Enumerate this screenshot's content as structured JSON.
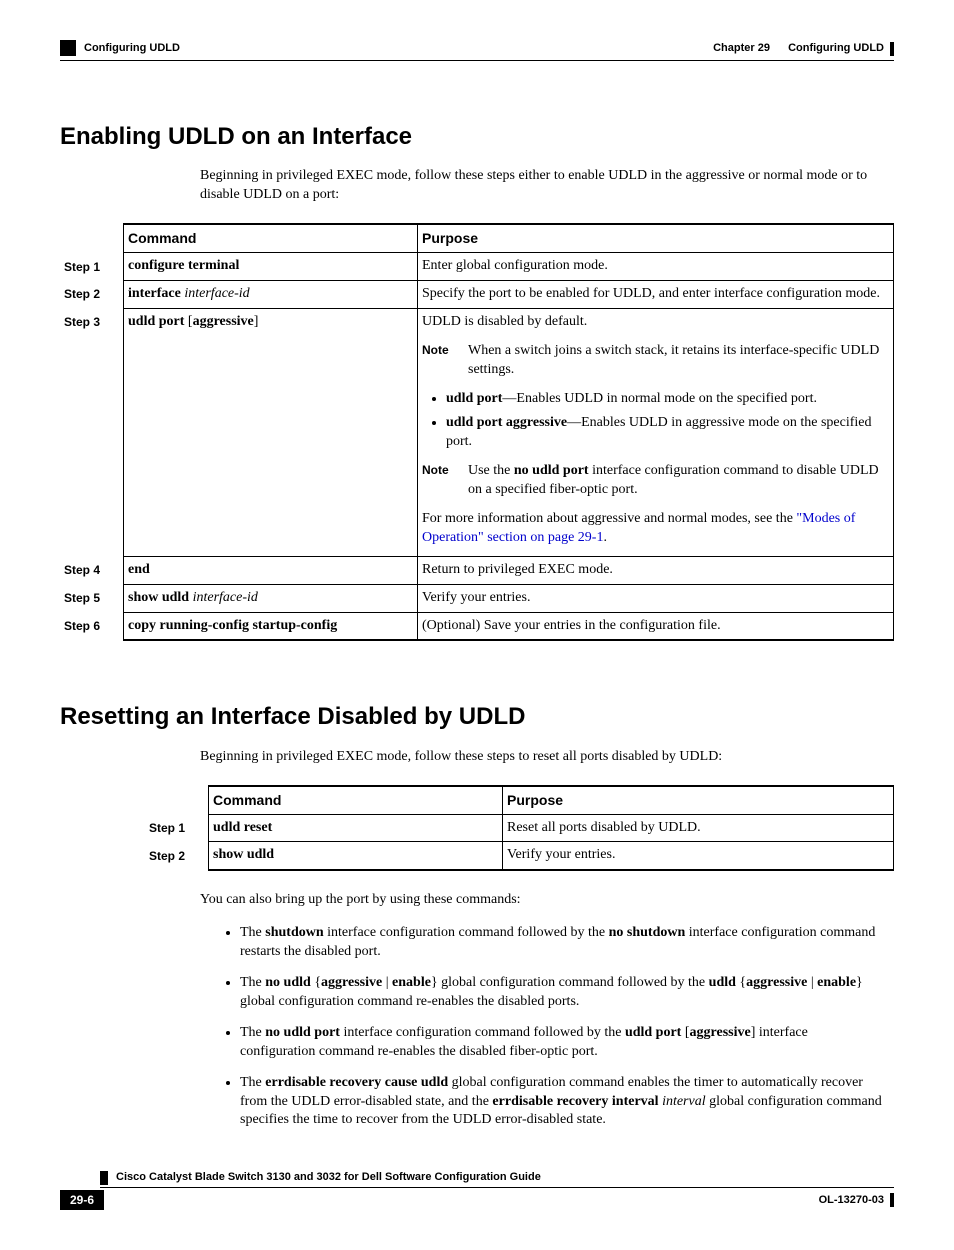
{
  "header": {
    "left": "Configuring UDLD",
    "right_chapter": "Chapter 29",
    "right_title": "Configuring UDLD"
  },
  "section1": {
    "title": "Enabling UDLD on an Interface",
    "intro": "Beginning in privileged EXEC mode, follow these steps either to enable UDLD in the aggressive or normal mode or to disable UDLD on a port:",
    "th_command": "Command",
    "th_purpose": "Purpose",
    "steps": {
      "s1": {
        "label": "Step 1",
        "cmd_b": "configure terminal",
        "purpose": "Enter global configuration mode."
      },
      "s2": {
        "label": "Step 2",
        "cmd_b": "interface",
        "cmd_i": "interface-id",
        "purpose": "Specify the port to be enabled for UDLD, and enter interface configuration mode."
      },
      "s3": {
        "label": "Step 3",
        "cmd_b": "udld port",
        "cmd_plain_open": " [",
        "cmd_b2": "aggressive",
        "cmd_plain_close": "]",
        "p1": "UDLD is disabled by default.",
        "note1_label": "Note",
        "note1_text": "When a switch joins a switch stack, it retains its interface-specific UDLD settings.",
        "b1_b": "udld port",
        "b1_rest": "—Enables UDLD in normal mode on the specified port.",
        "b2_b": "udld port aggressive",
        "b2_rest": "—Enables UDLD in aggressive mode on the specified port.",
        "note2_label": "Note",
        "note2_pre": "Use the ",
        "note2_b": "no udld port",
        "note2_post": " interface configuration command to disable UDLD on a specified fiber-optic port.",
        "p2_pre": "For more information about aggressive and normal modes, see the ",
        "p2_link": "\"Modes of Operation\" section on page 29-1",
        "p2_post": "."
      },
      "s4": {
        "label": "Step 4",
        "cmd_b": "end",
        "purpose": "Return to privileged EXEC mode."
      },
      "s5": {
        "label": "Step 5",
        "cmd_b": "show udld",
        "cmd_i": "interface-id",
        "purpose": "Verify your entries."
      },
      "s6": {
        "label": "Step 6",
        "cmd_b": "copy running-config startup-config",
        "purpose": "(Optional) Save your entries in the configuration file."
      }
    }
  },
  "section2": {
    "title": "Resetting an Interface Disabled by UDLD",
    "intro": "Beginning in privileged EXEC mode, follow these steps to reset all ports disabled by UDLD:",
    "th_command": "Command",
    "th_purpose": "Purpose",
    "steps": {
      "s1": {
        "label": "Step 1",
        "cmd_b": "udld reset",
        "purpose": "Reset all ports disabled by UDLD."
      },
      "s2": {
        "label": "Step 2",
        "cmd_b": "show udld",
        "purpose": "Verify your entries."
      }
    },
    "after": "You can also bring up the port by using these commands:",
    "bullets": {
      "b1": {
        "t1": "The ",
        "b1": "shutdown",
        "t2": " interface configuration command followed by the ",
        "b2": "no shutdown",
        "t3": " interface configuration command restarts the disabled port."
      },
      "b2": {
        "t1": "The ",
        "b1": "no udld",
        "t2": " {",
        "b2": "aggressive",
        "t3": " | ",
        "b3": "enable",
        "t4": "} global configuration command followed by the ",
        "b4": "udld",
        "t5": " {",
        "b5": "aggressive",
        "t6": " | ",
        "b6": "enable",
        "t7": "} global configuration command re-enables the disabled ports."
      },
      "b3": {
        "t1": "The ",
        "b1": "no udld port",
        "t2": " interface configuration command followed by the ",
        "b2": "udld port",
        "t3": " [",
        "b3": "aggressive",
        "t4": "] interface configuration command re-enables the disabled fiber-optic port."
      },
      "b4": {
        "t1": "The ",
        "b1": "errdisable recovery cause udld",
        "t2": " global configuration command enables the timer to automatically recover from the UDLD error-disabled state, and the ",
        "b2": "errdisable recovery interval",
        "t3": " ",
        "i1": "interval",
        "t4": " global configuration command specifies the time to recover from the UDLD error-disabled state."
      }
    }
  },
  "footer": {
    "guide": "Cisco Catalyst Blade Switch 3130 and 3032 for Dell Software Configuration Guide",
    "page": "29-6",
    "docid": "OL-13270-03"
  }
}
